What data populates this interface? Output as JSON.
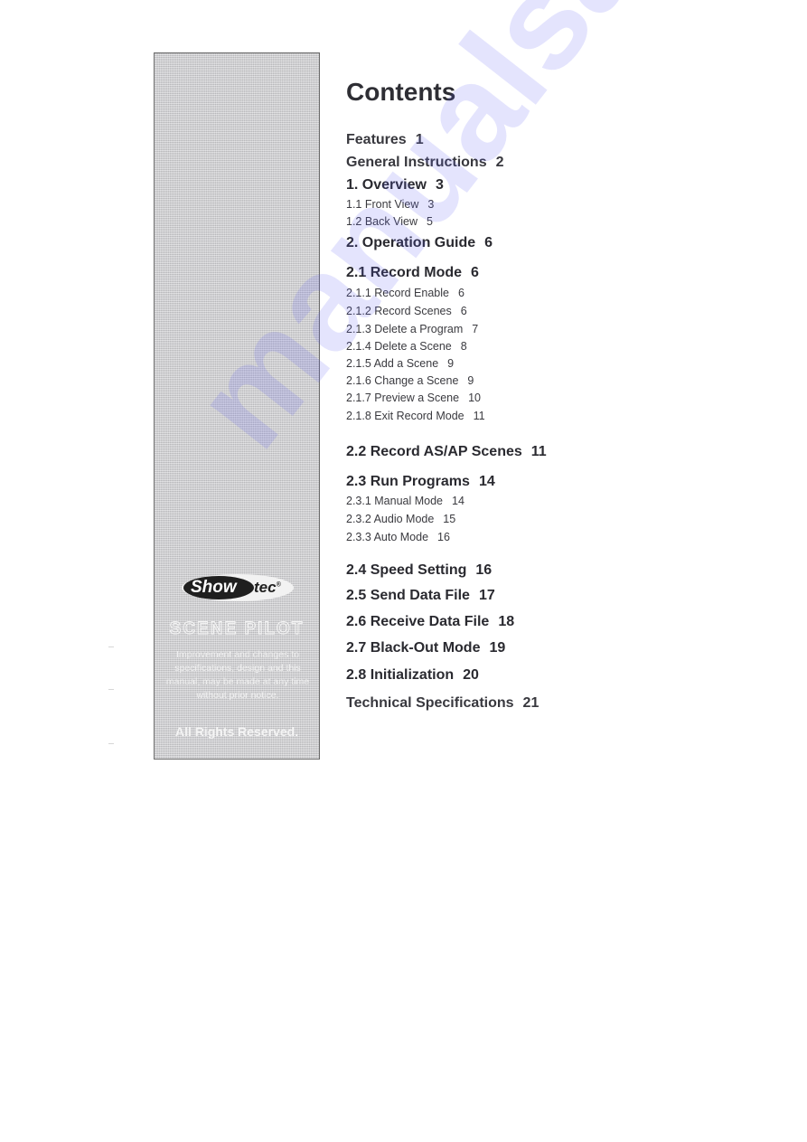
{
  "page": {
    "title": "Contents",
    "watermark_text": "manualsarchive.com"
  },
  "side_panel": {
    "logo": {
      "part1": "Show",
      "part2": "tec",
      "trademark": "®"
    },
    "product_name": "SCENE PILOT",
    "notice": "Improvement and changes to specifications, design and this manual, may be made at any time without prior notice.",
    "rights": "All Rights Reserved."
  },
  "toc": [
    {
      "label": "Features",
      "page": "1",
      "level": "top"
    },
    {
      "label": "General Instructions",
      "page": "2",
      "level": "top"
    },
    {
      "label": "1. Overview",
      "page": "3",
      "level": "h1"
    },
    {
      "label": "1.1 Front View",
      "page": "3",
      "level": "sub"
    },
    {
      "label": "1.2 Back View",
      "page": "5",
      "level": "sub"
    },
    {
      "label": "2. Operation Guide",
      "page": "6",
      "level": "h1"
    },
    {
      "label": "2.1 Record Mode",
      "page": "6",
      "level": "h1"
    },
    {
      "label": "2.1.1 Record Enable",
      "page": "6",
      "level": "sub"
    },
    {
      "label": "2.1.2 Record Scenes",
      "page": "6",
      "level": "sub"
    },
    {
      "label": "2.1.3 Delete a Program",
      "page": "7",
      "level": "sub"
    },
    {
      "label": "2.1.4 Delete a Scene",
      "page": "8",
      "level": "sub"
    },
    {
      "label": "2.1.5 Add a Scene",
      "page": "9",
      "level": "sub"
    },
    {
      "label": "2.1.6 Change a Scene",
      "page": "9",
      "level": "sub"
    },
    {
      "label": "2.1.7 Preview a Scene",
      "page": "10",
      "level": "sub"
    },
    {
      "label": "2.1.8 Exit Record Mode",
      "page": "11",
      "level": "sub"
    },
    {
      "label": "2.2 Record AS/AP Scenes",
      "page": "11",
      "level": "h1"
    },
    {
      "label": "2.3 Run Programs",
      "page": "14",
      "level": "h1"
    },
    {
      "label": "2.3.1 Manual Mode",
      "page": "14",
      "level": "sub"
    },
    {
      "label": "2.3.2 Audio Mode",
      "page": "15",
      "level": "sub"
    },
    {
      "label": "2.3.3 Auto Mode",
      "page": "16",
      "level": "sub"
    },
    {
      "label": "2.4 Speed Setting",
      "page": "16",
      "level": "h1"
    },
    {
      "label": "2.5 Send Data File",
      "page": "17",
      "level": "h1"
    },
    {
      "label": "2.6 Receive Data File",
      "page": "18",
      "level": "h1"
    },
    {
      "label": "2.7 Black-Out Mode",
      "page": "19",
      "level": "h1"
    },
    {
      "label": "2.8 Initialization",
      "page": "20",
      "level": "h1"
    },
    {
      "label": "Technical Specifications",
      "page": "21",
      "level": "top"
    }
  ]
}
